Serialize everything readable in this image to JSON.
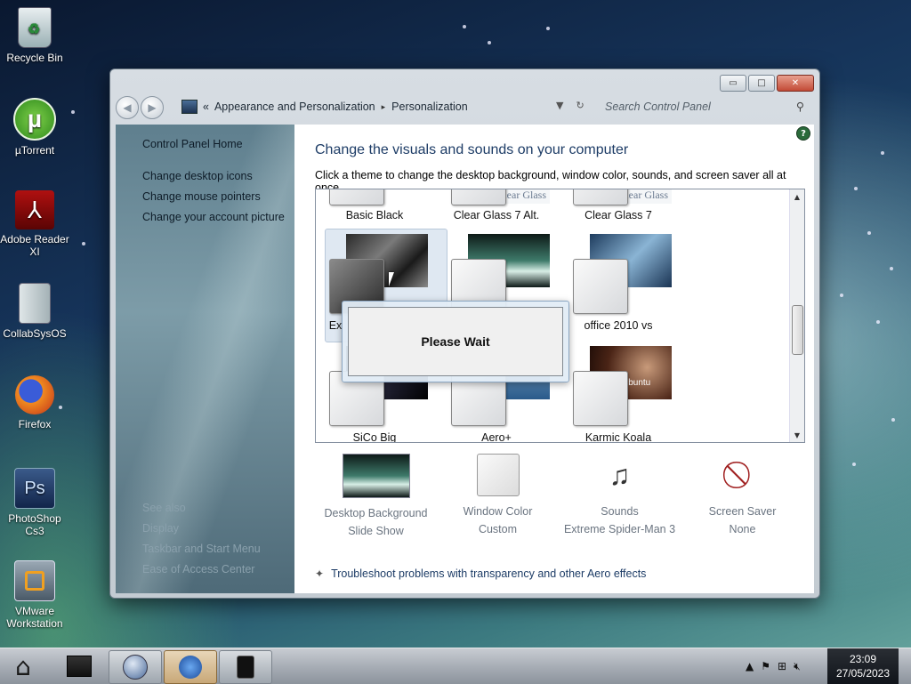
{
  "desktop": {
    "icons": [
      {
        "label": "Recycle Bin",
        "icon": "recycle-bin-icon"
      },
      {
        "label": "µTorrent",
        "icon": "utorrent-icon"
      },
      {
        "label": "Adobe Reader XI",
        "icon": "adobe-reader-icon"
      },
      {
        "label": "CollabSysOS",
        "icon": "folder-icon"
      },
      {
        "label": "Firefox",
        "icon": "firefox-icon"
      },
      {
        "label": "PhotoShop Cs3",
        "icon": "photoshop-icon"
      },
      {
        "label": "VMware Workstation",
        "icon": "vmware-icon"
      }
    ]
  },
  "window": {
    "caption": {
      "minimize": "▭",
      "maximize": "□",
      "close": "✕"
    },
    "breadcrumb": {
      "prefix": "«",
      "part1": "Appearance and Personalization",
      "sep": "▸",
      "part2": "Personalization"
    },
    "search_placeholder": "Search Control Panel",
    "left_pane": {
      "home": "Control Panel Home",
      "links": [
        "Change desktop icons",
        "Change mouse pointers",
        "Change your account picture"
      ],
      "see_also_title": "See also",
      "see_also": [
        "Display",
        "Taskbar and Start Menu",
        "Ease of Access Center"
      ]
    },
    "heading": "Change the visuals and sounds on your computer",
    "subheading": "Click a theme to change the desktop background, window color, sounds, and screen saver all at once.",
    "themes": [
      {
        "label": "Basic Black"
      },
      {
        "label": "Clear Glass 7 Alt.",
        "overlay": "Clear Glass"
      },
      {
        "label": "Clear Glass 7",
        "overlay": "Clear Glass"
      },
      {
        "label": "Ex",
        "selected": true
      },
      {
        "label": ""
      },
      {
        "label": "office 2010 vs"
      },
      {
        "label": "SiCo Big"
      },
      {
        "label": "Aero+"
      },
      {
        "label": "Karmic Koala",
        "overlay": "Ubuntu"
      }
    ],
    "bottom": [
      {
        "title": "Desktop Background",
        "sub": "Slide Show"
      },
      {
        "title": "Window Color",
        "sub": "Custom"
      },
      {
        "title": "Sounds",
        "sub": "Extreme Spider-Man 3"
      },
      {
        "title": "Screen Saver",
        "sub": "None"
      }
    ],
    "troubleshoot": "Troubleshoot problems with transparency and other Aero effects",
    "dialog_text": "Please Wait"
  },
  "taskbar": {
    "clock_time": "23:09",
    "clock_date": "27/05/2023"
  }
}
